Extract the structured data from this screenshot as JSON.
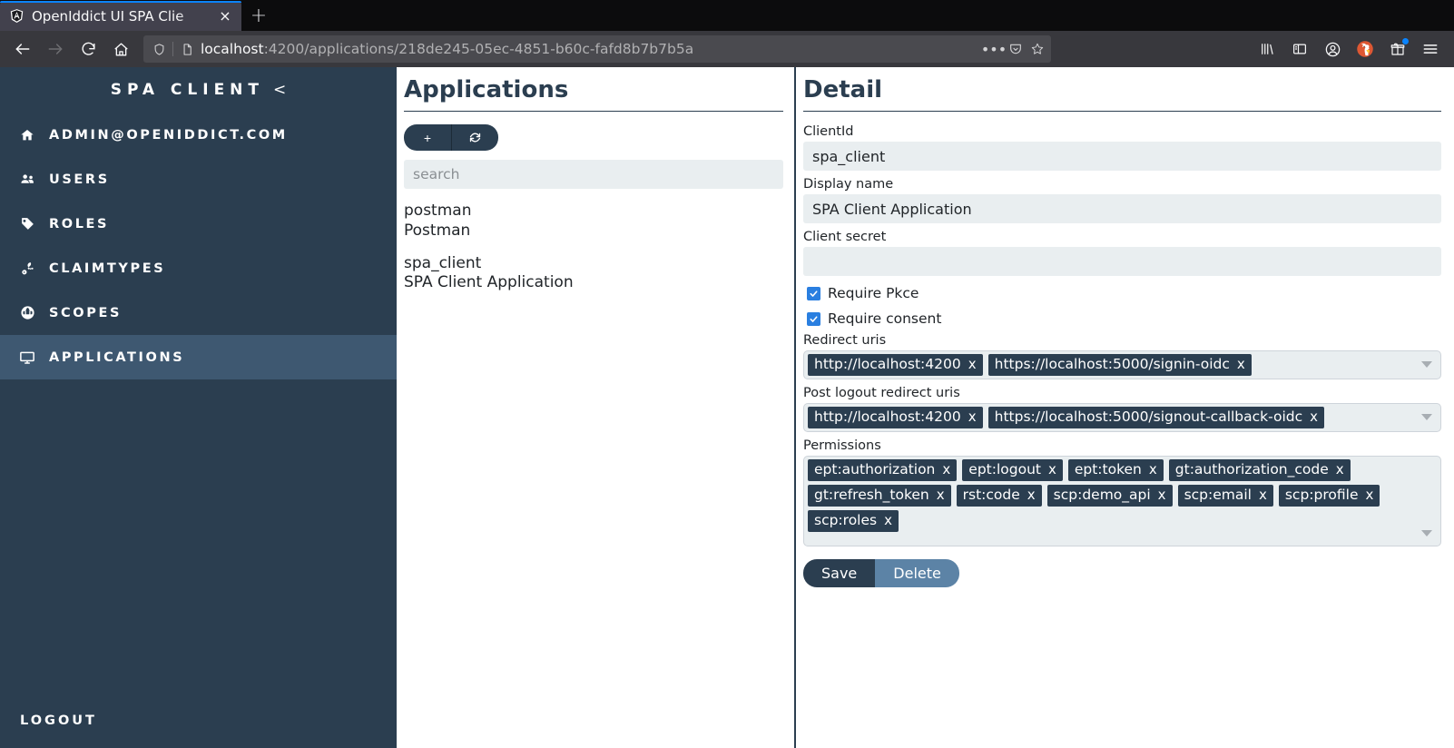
{
  "browser": {
    "tab": {
      "title": "OpenIddict UI SPA Clie",
      "favicon": "angular-icon",
      "close": "×"
    },
    "new_tab_label": "+",
    "nav": {
      "back": "←",
      "forward": "→",
      "reload": "↻",
      "home": "⌂"
    },
    "url": {
      "host": "localhost",
      "path": ":4200/applications/218de245-05ec-4851-b60c-fafd8b7b7b5a"
    },
    "url_actions": {
      "page_actions": "•••",
      "pocket": "pocket-icon",
      "bookmark": "star-icon"
    },
    "toolbar_icons": [
      "library-icon",
      "sidebar-icon",
      "account-icon",
      "duckduckgo-icon",
      "gift-icon",
      "menu-icon"
    ]
  },
  "sidebar": {
    "brand": "SPA CLIENT",
    "brand_caret": "<",
    "items": [
      {
        "label": "ADMIN@OPENIDDICT.COM",
        "icon": "home-icon",
        "active": false
      },
      {
        "label": "USERS",
        "icon": "users-icon",
        "active": false
      },
      {
        "label": "ROLES",
        "icon": "tag-icon",
        "active": false
      },
      {
        "label": "CLAIMTYPES",
        "icon": "key-icon",
        "active": false
      },
      {
        "label": "SCOPES",
        "icon": "globe-icon",
        "active": false
      },
      {
        "label": "APPLICATIONS",
        "icon": "desktop-icon",
        "active": true
      }
    ],
    "logout": "LOGOUT"
  },
  "list_panel": {
    "title": "Applications",
    "add_button": "+",
    "refresh_button": "refresh-icon",
    "search_placeholder": "search",
    "search_value": "",
    "applications": [
      {
        "client_id": "postman",
        "display_name": "Postman"
      },
      {
        "client_id": "spa_client",
        "display_name": "SPA Client Application"
      }
    ]
  },
  "detail": {
    "title": "Detail",
    "client_id": {
      "label": "ClientId",
      "value": "spa_client"
    },
    "display_name": {
      "label": "Display name",
      "value": "SPA Client Application"
    },
    "client_secret": {
      "label": "Client secret",
      "value": ""
    },
    "require_pkce": {
      "label": "Require Pkce",
      "checked": true
    },
    "require_consent": {
      "label": "Require consent",
      "checked": true
    },
    "redirect_uris": {
      "label": "Redirect uris",
      "tags": [
        "http://localhost:4200",
        "https://localhost:5000/signin-oidc"
      ]
    },
    "post_logout_redirect_uris": {
      "label": "Post logout redirect uris",
      "tags": [
        "http://localhost:4200",
        "https://localhost:5000/signout-callback-oidc"
      ]
    },
    "permissions": {
      "label": "Permissions",
      "tags": [
        "ept:authorization",
        "ept:logout",
        "ept:token",
        "gt:authorization_code",
        "gt:refresh_token",
        "rst:code",
        "scp:demo_api",
        "scp:email",
        "scp:profile",
        "scp:roles"
      ]
    },
    "tag_remove": "x",
    "save_label": "Save",
    "delete_label": "Delete"
  },
  "colors": {
    "sidebar": "#2b3e50",
    "sidebar_active": "#3e5871",
    "input_bg": "#e9eef0",
    "accent_blue": "#2a7fe0",
    "delete_btn": "#5c83a6"
  }
}
